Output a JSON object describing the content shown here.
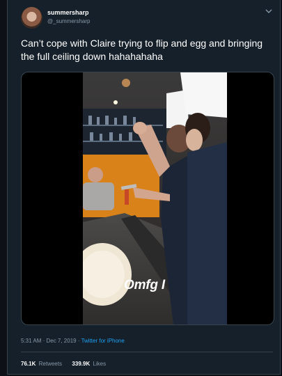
{
  "user": {
    "display_name": "summersharp",
    "handle": "@_summersharp",
    "avatar_icon": "profile-avatar"
  },
  "tweet": {
    "text": "Can’t cope with Claire trying to flip and egg and bringing the full ceiling down hahahahaha"
  },
  "media": {
    "caption": "Omfg I"
  },
  "meta": {
    "timestamp": "5:31 AM · Dec 7, 2019 · ",
    "source": "Twitter for iPhone"
  },
  "stats": {
    "retweets_count": "76.1K",
    "retweets_label": "Retweets",
    "likes_count": "339.9K",
    "likes_label": "Likes"
  },
  "colors": {
    "background": "#15202b",
    "accent": "#1da1f2",
    "secondary_text": "#8899a6",
    "border": "#38444d"
  }
}
